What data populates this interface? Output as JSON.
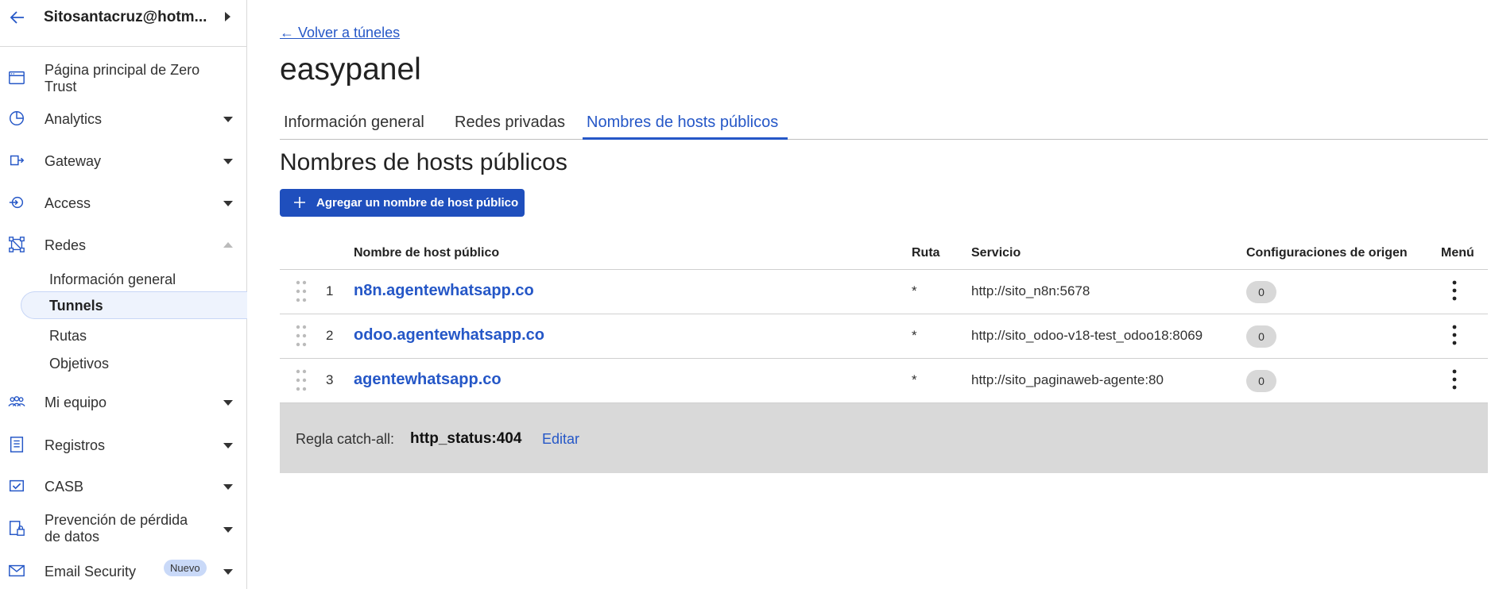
{
  "account": {
    "name": "Sitosantacruz@hotm..."
  },
  "sidebar": {
    "items": [
      {
        "label": "Página principal de Zero Trust",
        "icon": "browser-window-icon"
      },
      {
        "label": "Analytics",
        "icon": "pie-chart-icon"
      },
      {
        "label": "Gateway",
        "icon": "gateway-icon"
      },
      {
        "label": "Access",
        "icon": "access-icon"
      },
      {
        "label": "Redes",
        "icon": "network-icon"
      },
      {
        "label": "Mi equipo",
        "icon": "team-icon"
      },
      {
        "label": "Registros",
        "icon": "logs-icon"
      },
      {
        "label": "CASB",
        "icon": "casb-icon"
      },
      {
        "label": "Prevención de pérdida de datos",
        "icon": "dlp-icon"
      },
      {
        "label": "Email Security",
        "icon": "email-security-icon"
      }
    ],
    "redes_sub": [
      "Información general",
      "Tunnels",
      "Rutas",
      "Objetivos"
    ],
    "email_badge": "Nuevo"
  },
  "main": {
    "back_link": "← Volver a túneles",
    "title": "easypanel",
    "tabs": [
      "Información general",
      "Redes privadas",
      "Nombres de hosts públicos"
    ],
    "active_tab": 2,
    "section_title": "Nombres de hosts públicos",
    "add_button": "Agregar un nombre de host público"
  },
  "table": {
    "headers": [
      "Nombre de host público",
      "Ruta",
      "Servicio",
      "Configuraciones de origen",
      "Menú"
    ],
    "rows": [
      {
        "num": "1",
        "host": "n8n.agentewhatsapp.co",
        "path": "*",
        "service": "http://sito_n8n:5678",
        "origin": "0"
      },
      {
        "num": "2",
        "host": "odoo.agentewhatsapp.co",
        "path": "*",
        "service": "http://sito_odoo-v18-test_odoo18:8069",
        "origin": "0"
      },
      {
        "num": "3",
        "host": "agentewhatsapp.co",
        "path": "*",
        "service": "http://sito_paginaweb-agente:80",
        "origin": "0"
      }
    ]
  },
  "catchall": {
    "label": "Regla catch-all:",
    "value": "http_status:404",
    "edit": "Editar"
  },
  "colors": {
    "accent": "#2557c7",
    "button": "#1f4fbd",
    "catchall_bg": "#d9d9d9"
  }
}
